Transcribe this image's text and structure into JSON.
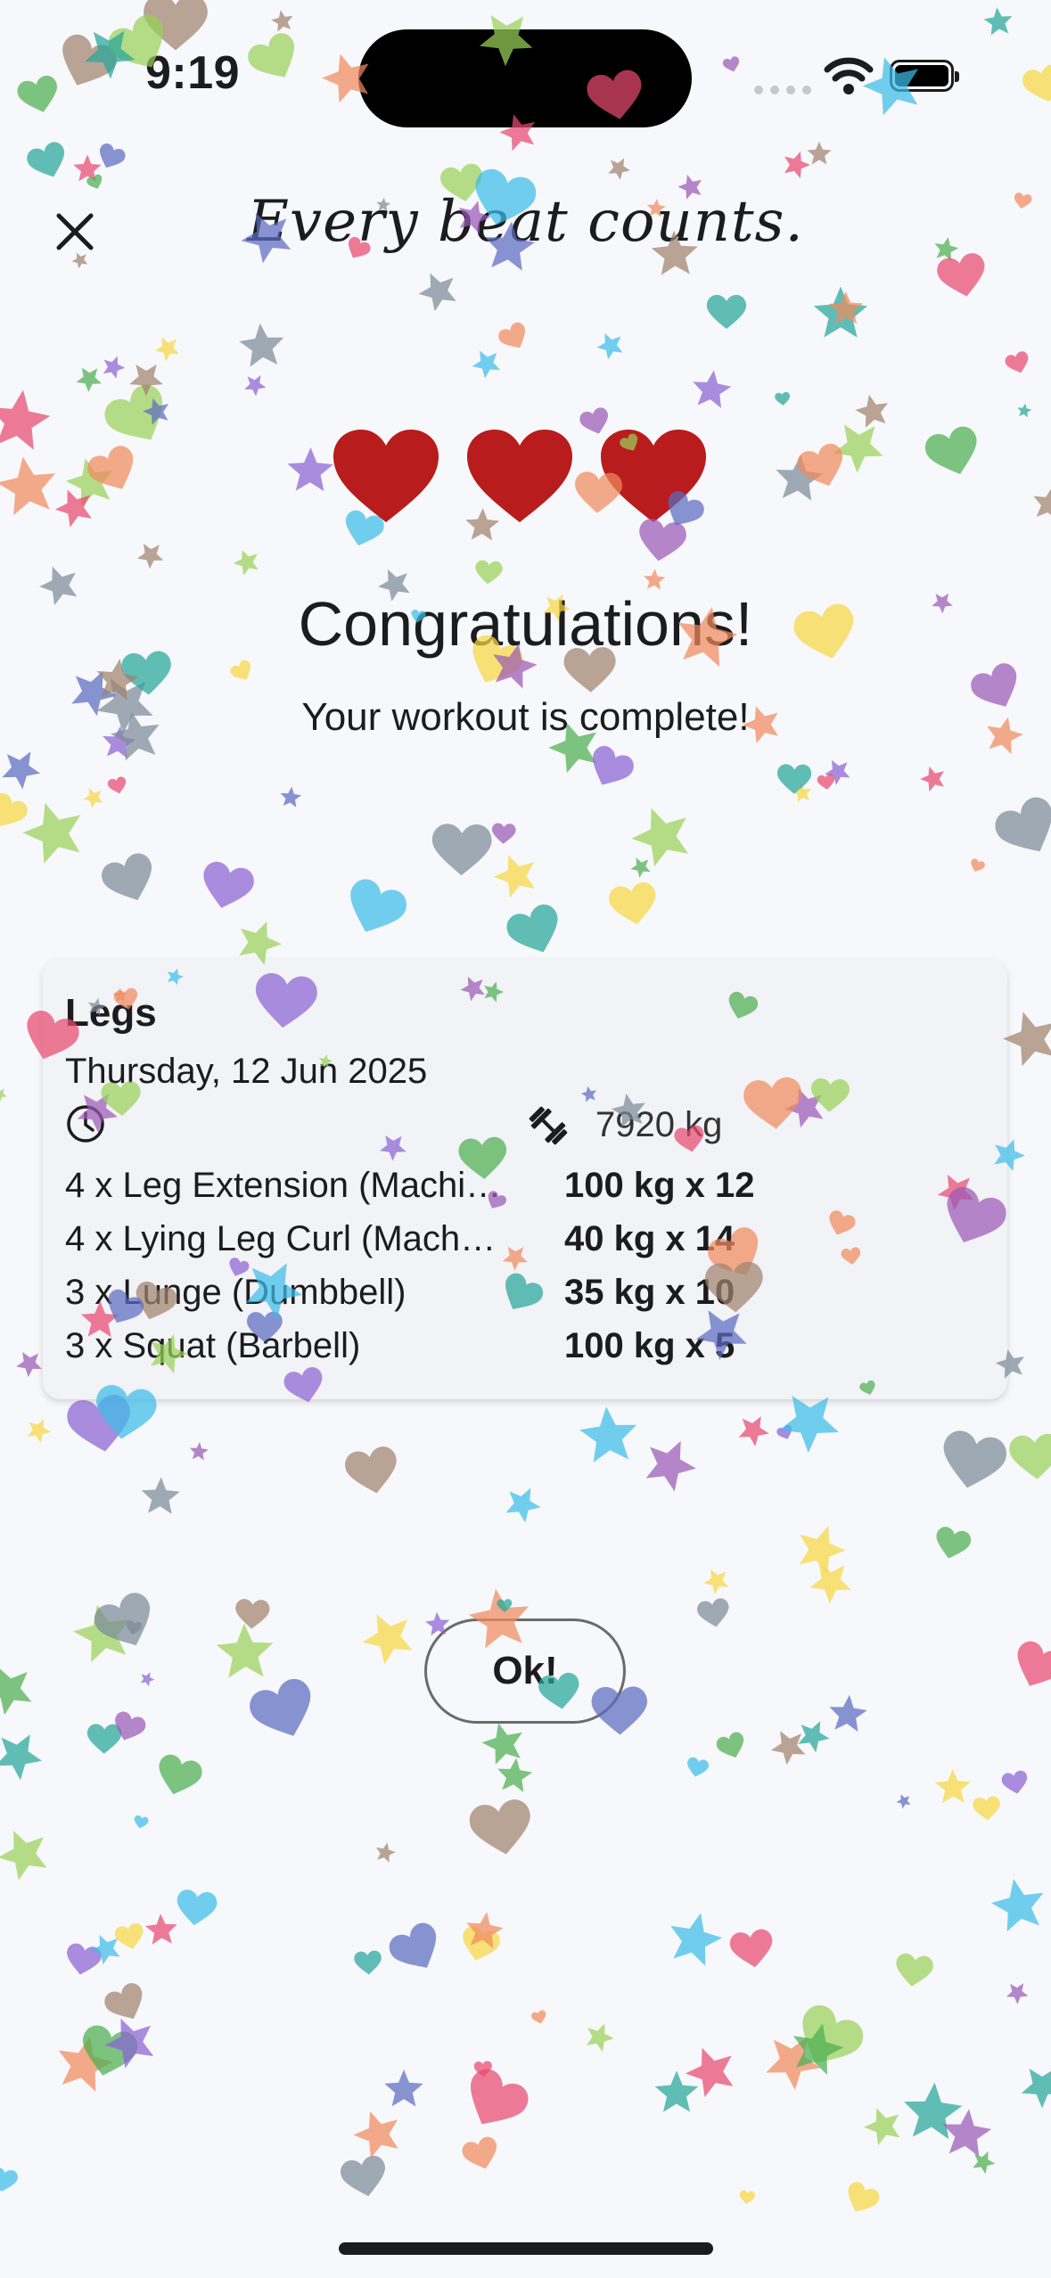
{
  "status_bar": {
    "time": "9:19"
  },
  "header": {
    "title": "Every beat counts."
  },
  "hearts": {
    "count": 3,
    "color": "#b81c1c"
  },
  "message": {
    "title": "Congratulations!",
    "subtitle": "Your workout is complete!"
  },
  "workout": {
    "name": "Legs",
    "date": "Thursday, 12 Jun 2025",
    "volume": "7920 kg",
    "exercises": [
      {
        "name": "4 x Leg Extension (Machi…",
        "best_set": "100 kg x 12"
      },
      {
        "name": "4 x Lying Leg Curl (Mach…",
        "best_set": "40 kg x 14"
      },
      {
        "name": "3 x Lunge (Dumbbell)",
        "best_set": "35 kg x 10"
      },
      {
        "name": "3 x Squat (Barbell)",
        "best_set": "100 kg x 5"
      }
    ]
  },
  "actions": {
    "ok_label": "Ok!"
  },
  "confetti": {
    "colors": [
      "#e84a6f",
      "#f6d743",
      "#3dbce7",
      "#8a63d2",
      "#4caf50",
      "#f08a5d",
      "#7c8a99",
      "#9ad159",
      "#9b59b6",
      "#26a69a",
      "#a0826d",
      "#5c6bc0"
    ]
  }
}
